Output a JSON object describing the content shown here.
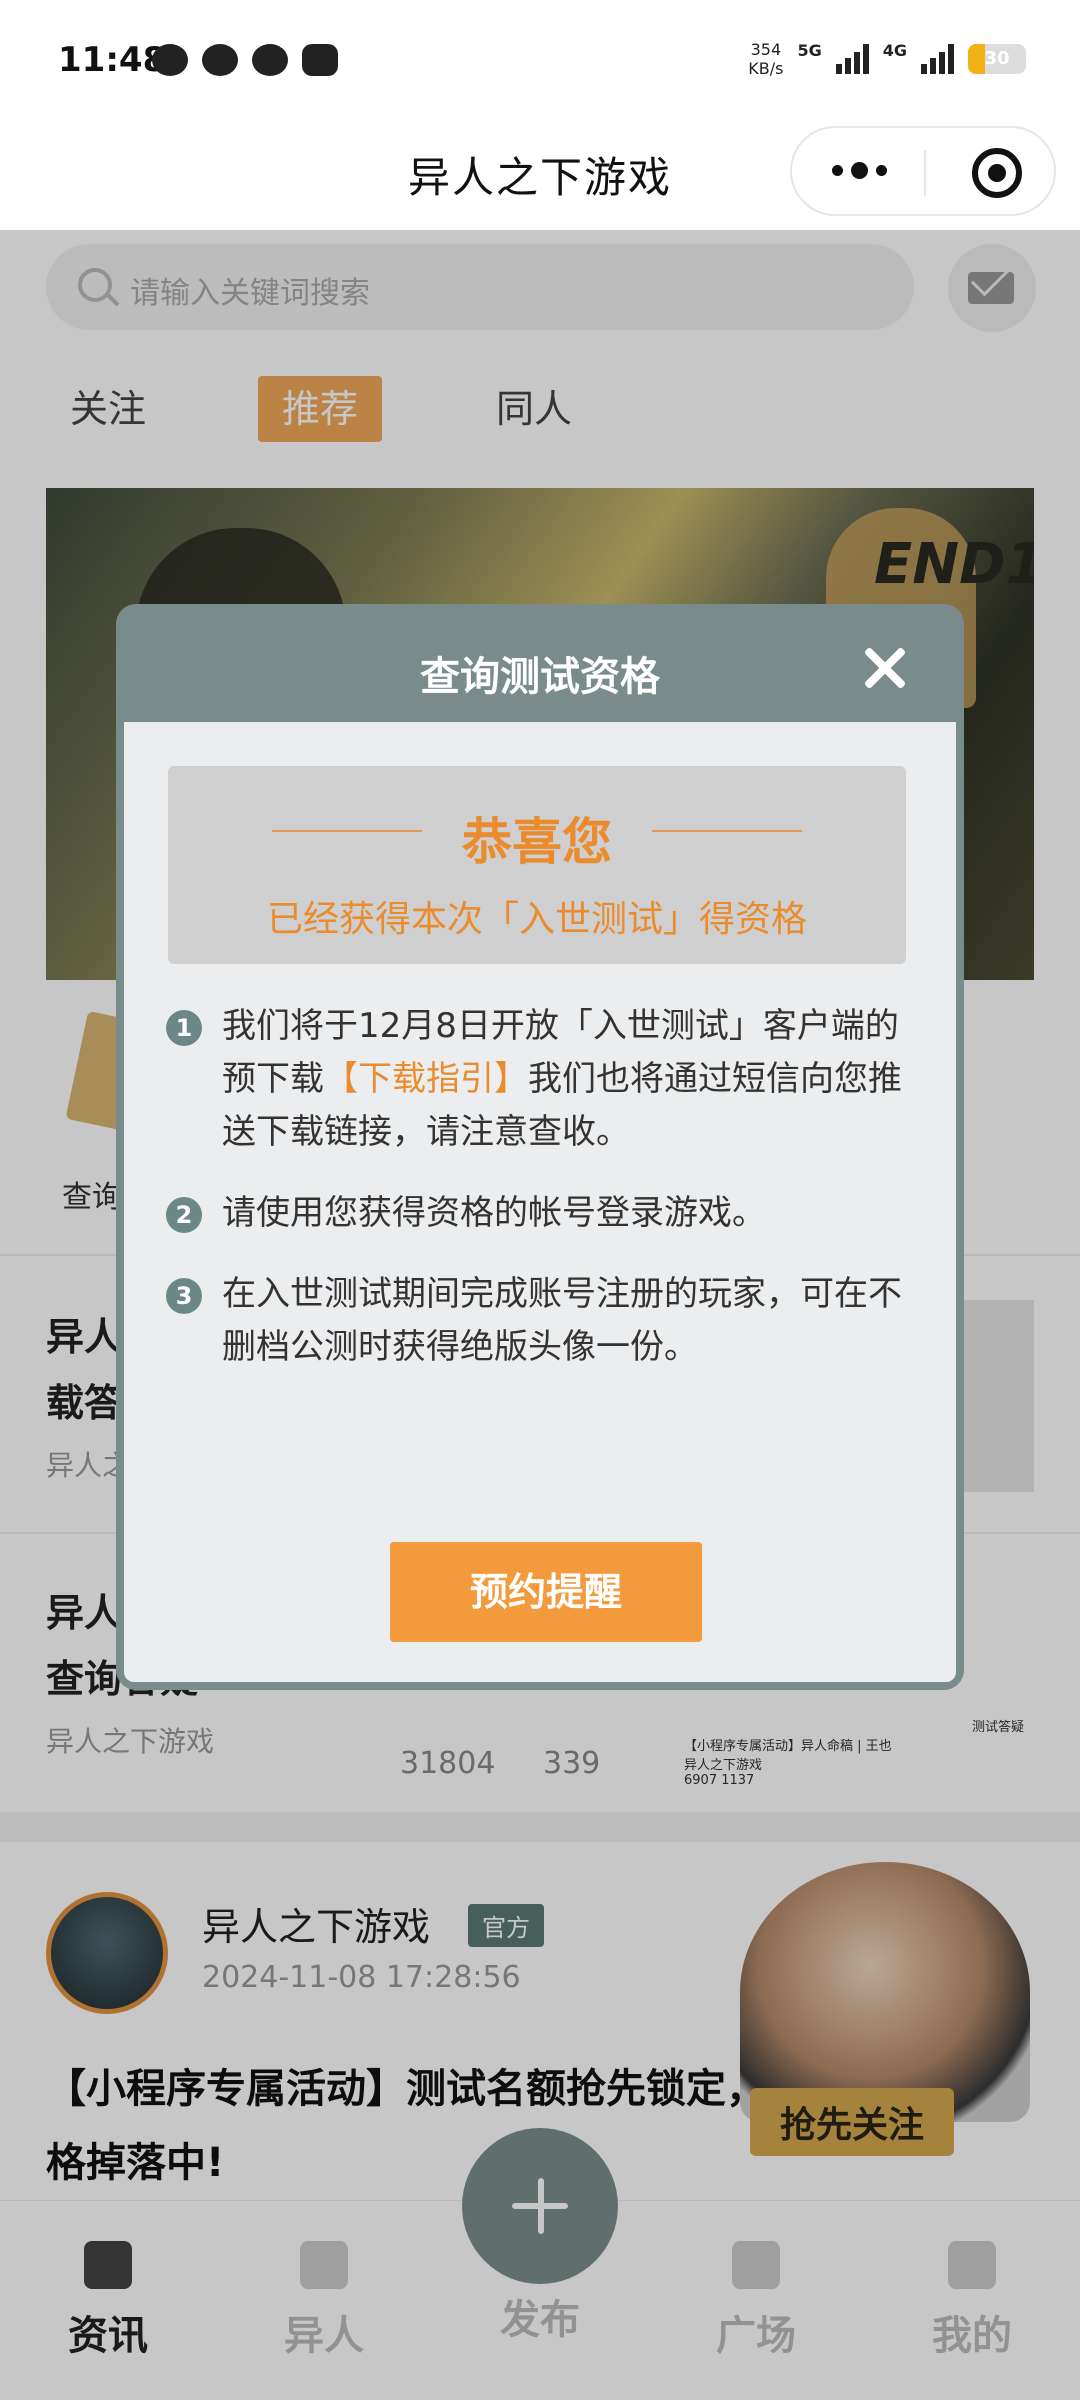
{
  "status_bar": {
    "time": "11:48",
    "speed_value": "354",
    "speed_unit": "KB/s",
    "net1": "5G",
    "net2": "4G",
    "battery": "30",
    "battery_level": 0.3,
    "icons": [
      "message-icon",
      "weibo-icon",
      "wechat-icon",
      "app-icon"
    ]
  },
  "navbar": {
    "title": "异人之下游戏"
  },
  "search": {
    "placeholder": "请输入关键词搜索"
  },
  "tabs": [
    {
      "label": "关注"
    },
    {
      "label": "推荐",
      "active": true
    },
    {
      "label": "同人"
    }
  ],
  "banner": {
    "sign_text": "END1"
  },
  "quick_entry": {
    "label": "查询"
  },
  "articles": [
    {
      "title_line1": "异人",
      "title_line2": "载答",
      "meta": "异人之"
    },
    {
      "title_line1": "异人",
      "title_line2": "查询答疑",
      "author": "异人之下游戏",
      "views": "31804",
      "comments": "339"
    }
  ],
  "thumb_caption": {
    "title": "【小程序专属活动】异人命稿 | 王也",
    "source": "异人之下游戏",
    "views": "6907",
    "comments": "1137",
    "tag": "测试答疑"
  },
  "post": {
    "author": "异人之下游戏",
    "badge": "官方",
    "time": "2024-11-08 17:28:56",
    "title": "【小程序专属活动】测试名额抢先锁定，50名额测试资格掉落中!",
    "follow_label": "抢先关注"
  },
  "tabbar": [
    {
      "label": "资讯",
      "active": true
    },
    {
      "label": "异人"
    },
    {
      "label": "发布"
    },
    {
      "label": "广场"
    },
    {
      "label": "我的"
    }
  ],
  "modal": {
    "title": "查询测试资格",
    "congrats": "恭喜您",
    "subtitle": "已经获得本次「入世测试」得资格",
    "items": [
      {
        "num": "1",
        "text_before": "我们将于12月8日开放「入世测试」客户端的预下载",
        "link": "【下载指引】",
        "text_after": "我们也将通过短信向您推送下载链接，请注意查收。"
      },
      {
        "num": "2",
        "text": "请使用您获得资格的帐号登录游戏。"
      },
      {
        "num": "3",
        "text": "在入世测试期间完成账号注册的玩家，可在不删档公测时获得绝版头像一份。"
      }
    ],
    "button": "预约提醒"
  }
}
